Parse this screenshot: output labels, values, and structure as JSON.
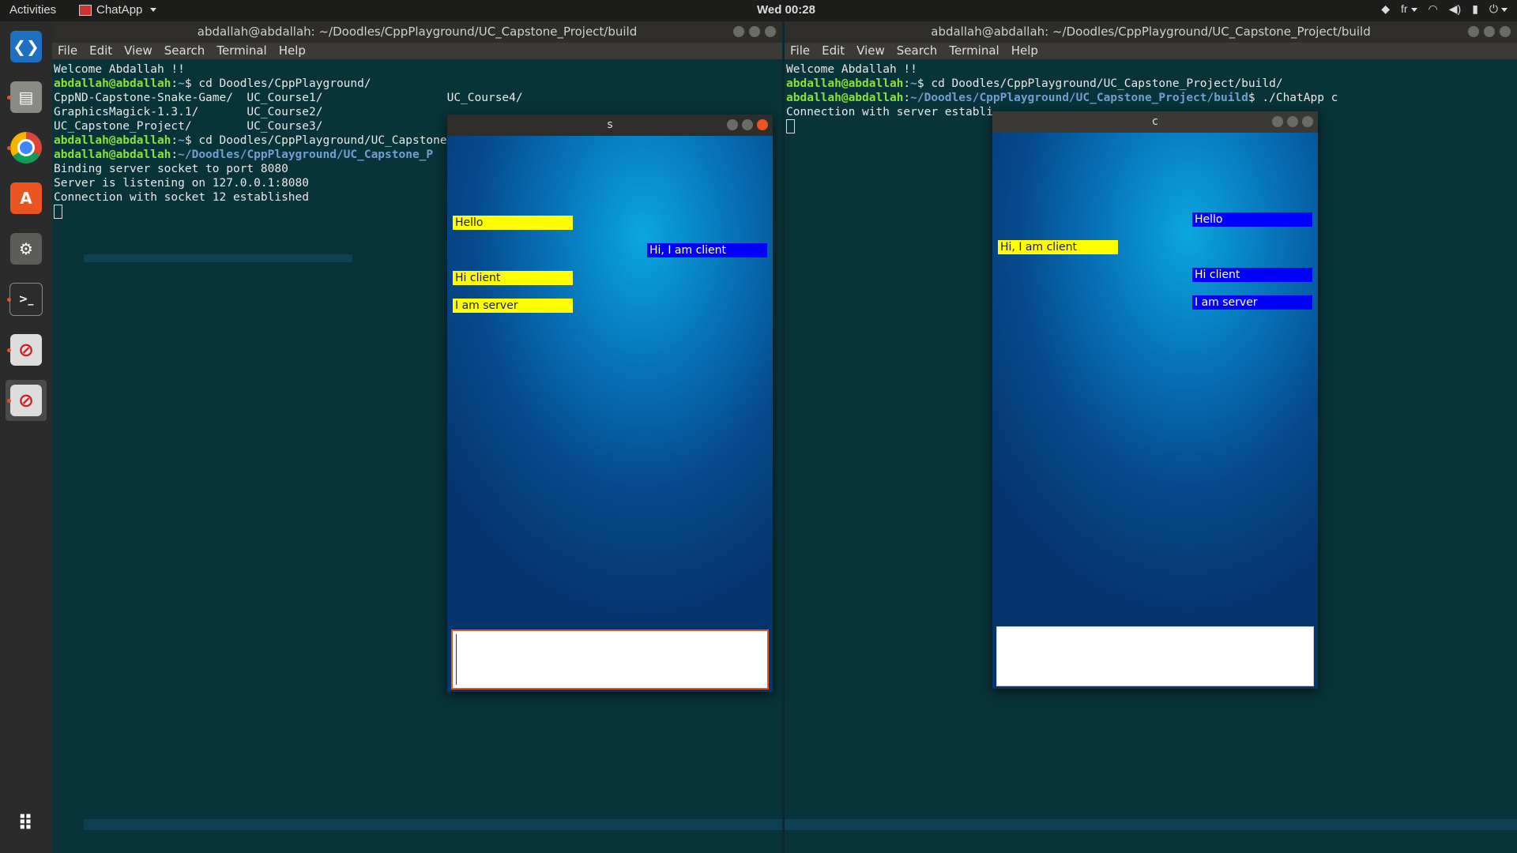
{
  "topbar": {
    "activities": "Activities",
    "app_name": "ChatApp",
    "clock": "Wed 00:28",
    "keyboard_layout": "fr"
  },
  "dock": {
    "items": [
      {
        "name": "vscode-icon"
      },
      {
        "name": "files-icon"
      },
      {
        "name": "chrome-icon"
      },
      {
        "name": "software-center-icon"
      },
      {
        "name": "settings-icon"
      },
      {
        "name": "terminal-icon"
      },
      {
        "name": "chatapp-icon-1"
      },
      {
        "name": "chatapp-icon-2"
      },
      {
        "name": "show-apps-icon"
      }
    ]
  },
  "menu": [
    "File",
    "Edit",
    "View",
    "Search",
    "Terminal",
    "Help"
  ],
  "left_terminal": {
    "title": "abdallah@abdallah: ~/Doodles/CppPlayground/UC_Capstone_Project/build",
    "welcome": "Welcome Abdallah !!",
    "prompt_user": "abdallah@abdallah",
    "cmd1_path": "~",
    "cmd1": "cd Doodles/CppPlayground/",
    "ls1": "CppND-Capstone-Snake-Game/  UC_Course1/                  UC_Course4/",
    "ls2": "GraphicsMagick-1.3.1/       UC_Course2/",
    "ls3": "UC_Capstone_Project/        UC_Course3/",
    "cmd2_path": "~",
    "cmd2": "cd Doodles/CppPlayground/UC_Capstone_Project/build/",
    "cmd3_path": "~/Doodles/CppPlayground/UC_Capstone_P",
    "out1": "Binding server socket to port 8080",
    "out2": "Server is listening on 127.0.0.1:8080",
    "out3": "Connection with socket 12 established"
  },
  "right_terminal": {
    "title": "abdallah@abdallah: ~/Doodles/CppPlayground/UC_Capstone_Project/build",
    "welcome": "Welcome Abdallah !!",
    "prompt_user": "abdallah@abdallah",
    "cmd1_path": "~",
    "cmd1": "cd Doodles/CppPlayground/UC_Capstone_Project/build/",
    "cmd2_path": "~/Doodles/CppPlayground/UC_Capstone_Project/build",
    "cmd2": "./ChatApp c",
    "out1": "Connection with server establi"
  },
  "server_window": {
    "title": "s",
    "messages": [
      {
        "text": "Hello",
        "side": "left",
        "color": "#ffff00"
      },
      {
        "text": "Hi, I am client",
        "side": "right",
        "color": "#0000ff"
      },
      {
        "text": "Hi client",
        "side": "left",
        "color": "#ffff00"
      },
      {
        "text": "I am server",
        "side": "left",
        "color": "#ffff00"
      }
    ]
  },
  "client_window": {
    "title": "c",
    "messages": [
      {
        "text": "Hello",
        "side": "right",
        "color": "#0000ff"
      },
      {
        "text": "Hi, I am client",
        "side": "left",
        "color": "#ffff00"
      },
      {
        "text": "Hi client",
        "side": "right",
        "color": "#0000ff"
      },
      {
        "text": "I am server",
        "side": "right",
        "color": "#0000ff"
      }
    ]
  },
  "colors": {
    "prompt_user": "#8ae234",
    "prompt_path": "#729fcf",
    "accent": "#e95420"
  }
}
